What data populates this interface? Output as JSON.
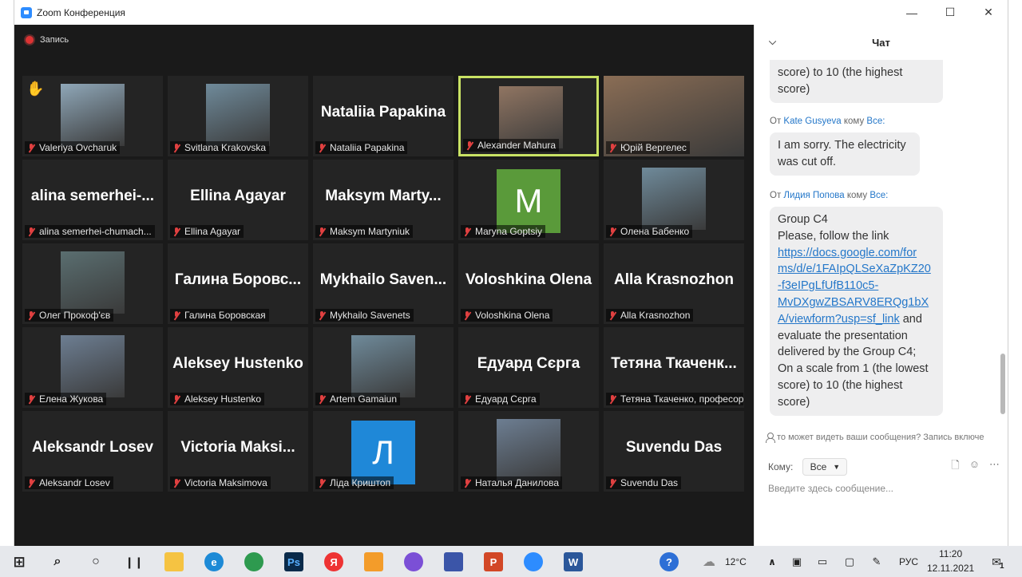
{
  "window": {
    "title": "Zoom Конференция"
  },
  "recording": {
    "label": "Запись"
  },
  "participants": [
    {
      "name": "Valeriya Ovcharuk",
      "big": "",
      "hand": true
    },
    {
      "name": "Svitlana Krakovska",
      "big": ""
    },
    {
      "name": "Nataliia Papakina",
      "big": "Nataliia Papakina"
    },
    {
      "name": "Alexander Mahura",
      "big": "",
      "active": true
    },
    {
      "name": "Юрій Вергелес",
      "big": ""
    },
    {
      "name": "alina semerhei-chumach...",
      "big": "alina semerhei-..."
    },
    {
      "name": "Ellina Agayar",
      "big": "Ellina Agayar"
    },
    {
      "name": "Maksym Martyniuk",
      "big": "Maksym Marty..."
    },
    {
      "name": "Maryna Goptsiy",
      "big": "",
      "letter": "M"
    },
    {
      "name": "Олена Бабенко",
      "big": ""
    },
    {
      "name": "Олег Прокоф'єв",
      "big": ""
    },
    {
      "name": "Галина Боровская",
      "big": "Галина Боровс..."
    },
    {
      "name": "Mykhailo Savenets",
      "big": "Mykhailo Saven..."
    },
    {
      "name": "Voloshkina Olena",
      "big": "Voloshkina Olena"
    },
    {
      "name": "Alla Krasnozhon",
      "big": "Alla Krasnozhon"
    },
    {
      "name": "Елена Жукова",
      "big": ""
    },
    {
      "name": "Aleksey Hustenko",
      "big": "Aleksey Hustenko"
    },
    {
      "name": "Artem Gamaiun",
      "big": ""
    },
    {
      "name": "Едуард Сєрга",
      "big": "Едуард Сєрга"
    },
    {
      "name": "Тетяна Ткаченко, професор",
      "big": "Тетяна Ткаченк..."
    },
    {
      "name": "Aleksandr Losev",
      "big": "Aleksandr Losev"
    },
    {
      "name": "Victoria Maksimova",
      "big": "Victoria Maksi..."
    },
    {
      "name": "Ліда Криштоп",
      "big": "",
      "letter": "Л"
    },
    {
      "name": "Наталья Данилова",
      "big": ""
    },
    {
      "name": "Suvendu Das",
      "big": "Suvendu Das"
    }
  ],
  "chat": {
    "title": "Чат",
    "msg0": {
      "line1": "score) to 10 (the highest",
      "line2": "score)"
    },
    "msg1": {
      "from_prefix": "От",
      "from_name": "Kate Gusyeva",
      "to_word": "кому",
      "to_name": "Все:",
      "line1": "I am sorry. The electricity",
      "line2": "was cut off."
    },
    "msg2": {
      "from_prefix": "От",
      "from_name": "Лидия Попова",
      "to_word": "кому",
      "to_name": "Все:",
      "line1": "Group C4",
      "line2": "Please, follow the link",
      "link1": "https://docs.google.com/for",
      "link2": "ms/d/e/1FAIpQLSeXaZpKZ20",
      "link3": "-f3eIPgLfUfB110c5-",
      "link4": "MvDXgwZBSARV8ERQg1bX",
      "link5": "A/viewform?usp=sf_link",
      "link_tail": " and",
      "line3": "evaluate the presentation",
      "line4": "delivered by the Group C4;",
      "line5": "On a scale from 1 (the lowest",
      "line6": "score) to 10 (the highest",
      "line7": "score)"
    },
    "notice": "то может видеть ваши сообщения? Запись включе",
    "to_label": "Кому:",
    "to_value": "Все",
    "placeholder": "Введите здесь сообщение..."
  },
  "taskbar": {
    "temperature": "12°C",
    "lang": "РУС",
    "time": "11:20",
    "date": "12.11.2021",
    "notif_count": "1"
  }
}
